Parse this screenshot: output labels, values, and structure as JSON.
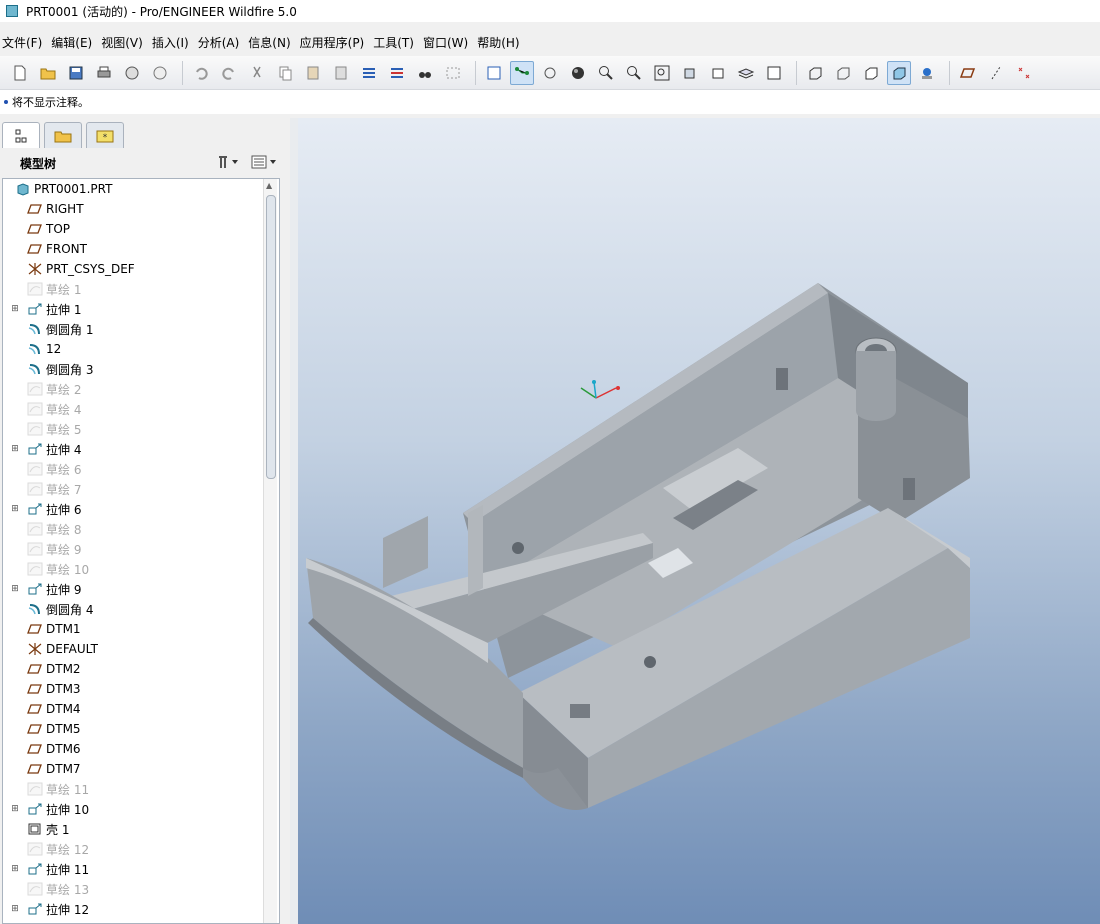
{
  "window": {
    "title": "PRT0001 (活动的) - Pro/ENGINEER Wildfire 5.0"
  },
  "menu": [
    "文件(F)",
    "编辑(E)",
    "视图(V)",
    "插入(I)",
    "分析(A)",
    "信息(N)",
    "应用程序(P)",
    "工具(T)",
    "窗口(W)",
    "帮助(H)"
  ],
  "message": "将不显示注释。",
  "model_tree": {
    "title": "模型树",
    "items": [
      {
        "label": "PRT0001.PRT",
        "icon": "part-icon",
        "expandable": false,
        "suppressed": false
      },
      {
        "label": "RIGHT",
        "icon": "datum-plane-icon",
        "expandable": false,
        "suppressed": false
      },
      {
        "label": "TOP",
        "icon": "datum-plane-icon",
        "expandable": false,
        "suppressed": false
      },
      {
        "label": "FRONT",
        "icon": "datum-plane-icon",
        "expandable": false,
        "suppressed": false
      },
      {
        "label": "PRT_CSYS_DEF",
        "icon": "csys-icon",
        "expandable": false,
        "suppressed": false
      },
      {
        "label": "草绘 1",
        "icon": "sketch-icon",
        "expandable": false,
        "suppressed": true
      },
      {
        "label": "拉伸 1",
        "icon": "extrude-icon",
        "expandable": true,
        "suppressed": false
      },
      {
        "label": "倒圆角 1",
        "icon": "round-icon",
        "expandable": false,
        "suppressed": false
      },
      {
        "label": "12",
        "icon": "round-icon",
        "expandable": false,
        "suppressed": false
      },
      {
        "label": "倒圆角 3",
        "icon": "round-icon",
        "expandable": false,
        "suppressed": false
      },
      {
        "label": "草绘 2",
        "icon": "sketch-icon",
        "expandable": false,
        "suppressed": true
      },
      {
        "label": "草绘 4",
        "icon": "sketch-icon",
        "expandable": false,
        "suppressed": true
      },
      {
        "label": "草绘 5",
        "icon": "sketch-icon",
        "expandable": false,
        "suppressed": true
      },
      {
        "label": "拉伸 4",
        "icon": "extrude-icon",
        "expandable": true,
        "suppressed": false
      },
      {
        "label": "草绘 6",
        "icon": "sketch-icon",
        "expandable": false,
        "suppressed": true
      },
      {
        "label": "草绘 7",
        "icon": "sketch-icon",
        "expandable": false,
        "suppressed": true
      },
      {
        "label": "拉伸 6",
        "icon": "extrude-icon",
        "expandable": true,
        "suppressed": false
      },
      {
        "label": "草绘 8",
        "icon": "sketch-icon",
        "expandable": false,
        "suppressed": true
      },
      {
        "label": "草绘 9",
        "icon": "sketch-icon",
        "expandable": false,
        "suppressed": true
      },
      {
        "label": "草绘 10",
        "icon": "sketch-icon",
        "expandable": false,
        "suppressed": true
      },
      {
        "label": "拉伸 9",
        "icon": "extrude-icon",
        "expandable": true,
        "suppressed": false
      },
      {
        "label": "倒圆角 4",
        "icon": "round-icon",
        "expandable": false,
        "suppressed": false
      },
      {
        "label": "DTM1",
        "icon": "datum-plane-icon",
        "expandable": false,
        "suppressed": false
      },
      {
        "label": "DEFAULT",
        "icon": "csys-icon",
        "expandable": false,
        "suppressed": false
      },
      {
        "label": "DTM2",
        "icon": "datum-plane-icon",
        "expandable": false,
        "suppressed": false
      },
      {
        "label": "DTM3",
        "icon": "datum-plane-icon",
        "expandable": false,
        "suppressed": false
      },
      {
        "label": "DTM4",
        "icon": "datum-plane-icon",
        "expandable": false,
        "suppressed": false
      },
      {
        "label": "DTM5",
        "icon": "datum-plane-icon",
        "expandable": false,
        "suppressed": false
      },
      {
        "label": "DTM6",
        "icon": "datum-plane-icon",
        "expandable": false,
        "suppressed": false
      },
      {
        "label": "DTM7",
        "icon": "datum-plane-icon",
        "expandable": false,
        "suppressed": false
      },
      {
        "label": "草绘 11",
        "icon": "sketch-icon",
        "expandable": false,
        "suppressed": true
      },
      {
        "label": "拉伸 10",
        "icon": "extrude-icon",
        "expandable": true,
        "suppressed": false
      },
      {
        "label": "壳 1",
        "icon": "shell-icon",
        "expandable": false,
        "suppressed": false
      },
      {
        "label": "草绘 12",
        "icon": "sketch-icon",
        "expandable": false,
        "suppressed": true
      },
      {
        "label": "拉伸 11",
        "icon": "extrude-icon",
        "expandable": true,
        "suppressed": false
      },
      {
        "label": "草绘 13",
        "icon": "sketch-icon",
        "expandable": false,
        "suppressed": true
      },
      {
        "label": "拉伸 12",
        "icon": "extrude-icon",
        "expandable": true,
        "suppressed": false
      }
    ]
  },
  "toolbar_icons": [
    "new-icon",
    "open-icon",
    "save-icon",
    "print-icon",
    "send-mail-icon",
    "send-link-icon",
    "undo-icon",
    "redo-icon",
    "cut-icon",
    "copy-icon",
    "paste-icon",
    "paste-special-icon",
    "regenerate-icon",
    "regen-manager-icon",
    "find-icon",
    "select-box-icon",
    "refit-icon",
    "spin-center-icon",
    "orient-icon",
    "appearance-icon",
    "zoom-in-icon",
    "zoom-out-icon",
    "refit-view-icon",
    "reorient-icon",
    "saved-views-icon",
    "layers-icon",
    "view-manager-icon",
    "wireframe-icon",
    "hidden-line-icon",
    "no-hidden-icon",
    "shading-icon",
    "enhanced-realism-icon",
    "datum-planes-icon",
    "datum-axes-icon",
    "datum-points-icon"
  ],
  "colors": {
    "viewport_top": "#e6ecf4",
    "viewport_bottom": "#6f8db6",
    "model_gray": "#9aa0a6"
  }
}
